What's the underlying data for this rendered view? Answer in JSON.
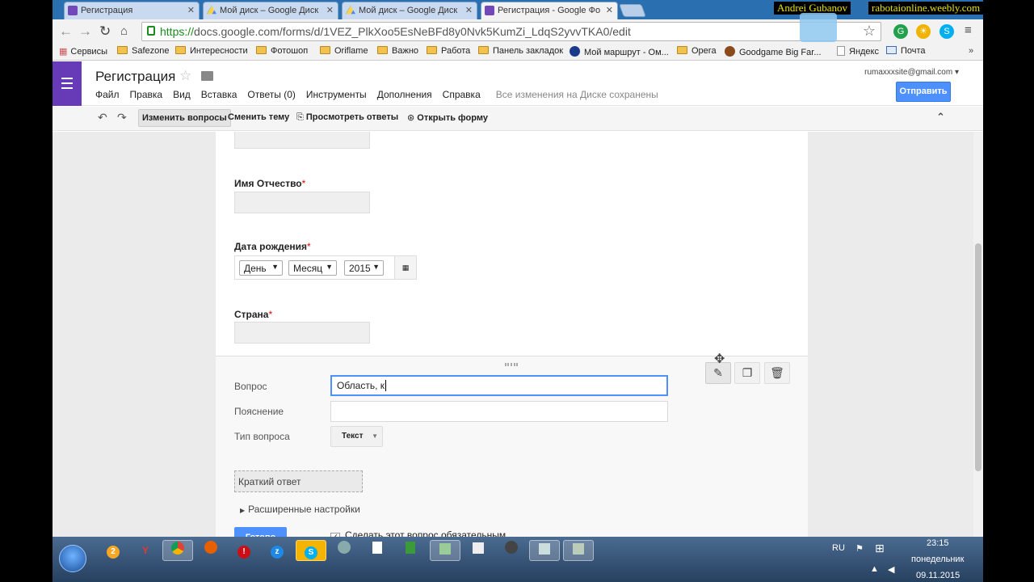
{
  "browser": {
    "tabs": [
      {
        "title": "Регистрация",
        "icon": "form"
      },
      {
        "title": "Мой диск – Google Диск",
        "icon": "drive"
      },
      {
        "title": "Мой диск – Google Диск",
        "icon": "drive"
      },
      {
        "title": "Регистрация - Google Фо",
        "icon": "form",
        "active": true
      }
    ],
    "overlay_left": "Andrei Gubanov",
    "overlay_right": "rabotaionline.weebly.com",
    "url_scheme": "https://",
    "url_rest": "docs.google.com/forms/d/1VEZ_PlkXoo5EsNeBFd8y0Nvk5KumZi_LdqS2yvvTKA0/edit",
    "bookmarks": [
      "Сервисы",
      "Safezone",
      "Интересности",
      "Фотошоп",
      "Oriflame",
      "Важно",
      "Работа",
      "Панель закладок",
      "Мой маршрут - Ом...",
      "Opera",
      "Goodgame Big Far...",
      "Яндекс",
      "Почта"
    ]
  },
  "header": {
    "title": "Регистрация",
    "menu": [
      "Файл",
      "Правка",
      "Вид",
      "Вставка",
      "Ответы (0)",
      "Инструменты",
      "Дополнения",
      "Справка"
    ],
    "save_status": "Все изменения на Диске сохранены",
    "account": "rumaxxxsite@gmail.com",
    "send_label": "Отправить"
  },
  "toolbar": {
    "edit_questions": "Изменить вопросы",
    "change_theme": "Сменить тему",
    "view_responses": "Просмотреть ответы",
    "open_form": "Открыть форму"
  },
  "form": {
    "q_patronymic": "Имя Отчество",
    "q_birthdate": "Дата рождения",
    "q_country": "Страна",
    "required_mark": "*",
    "date": {
      "day": "День",
      "month": "Месяц",
      "year": "2015"
    }
  },
  "edit_panel": {
    "question_label": "Вопрос",
    "question_value": "Область, к",
    "help_label": "Пояснение",
    "help_value": "",
    "type_label": "Тип вопроса",
    "type_value": "Текст",
    "short_answer": "Краткий ответ",
    "advanced": "Расширенные настройки",
    "done": "Готово",
    "required_label": "Сделать этот вопрос обязательным",
    "required_checked": true
  },
  "taskbar": {
    "lang": "RU",
    "time": "23:15",
    "weekday": "понедельник",
    "date": "09.11.2015"
  }
}
